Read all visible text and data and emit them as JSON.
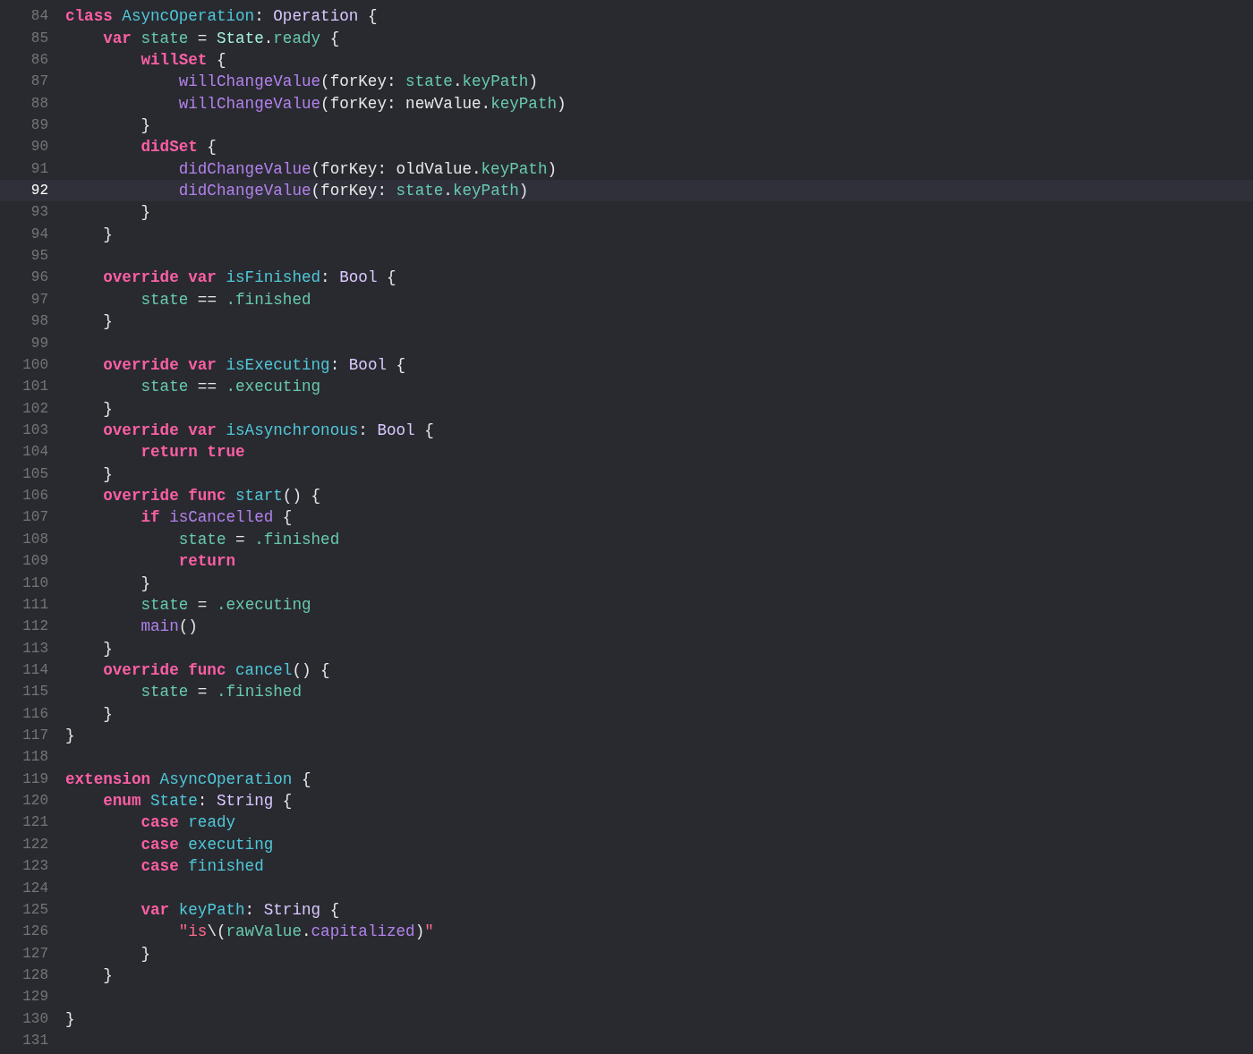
{
  "editor": {
    "lines": [
      {
        "number": "84",
        "selected": false,
        "tokens": [
          {
            "text": "class ",
            "kind": "keyword"
          },
          {
            "text": "AsyncOperation",
            "kind": "declaration"
          },
          {
            "text": ": ",
            "kind": "plain"
          },
          {
            "text": "Operation",
            "kind": "type"
          },
          {
            "text": " {",
            "kind": "plain"
          }
        ]
      },
      {
        "number": "85",
        "selected": false,
        "tokens": [
          {
            "text": "    var ",
            "kind": "keyword"
          },
          {
            "text": "state",
            "kind": "member"
          },
          {
            "text": " = ",
            "kind": "plain"
          },
          {
            "text": "State",
            "kind": "project-type"
          },
          {
            "text": ".",
            "kind": "plain"
          },
          {
            "text": "ready",
            "kind": "member"
          },
          {
            "text": " {",
            "kind": "plain"
          }
        ]
      },
      {
        "number": "86",
        "selected": false,
        "tokens": [
          {
            "text": "        willSet",
            "kind": "keyword"
          },
          {
            "text": " {",
            "kind": "plain"
          }
        ]
      },
      {
        "number": "87",
        "selected": false,
        "tokens": [
          {
            "text": "            willChangeValue",
            "kind": "method"
          },
          {
            "text": "(forKey: ",
            "kind": "plain"
          },
          {
            "text": "state",
            "kind": "member"
          },
          {
            "text": ".",
            "kind": "plain"
          },
          {
            "text": "keyPath",
            "kind": "member"
          },
          {
            "text": ")",
            "kind": "plain"
          }
        ]
      },
      {
        "number": "88",
        "selected": false,
        "tokens": [
          {
            "text": "            willChangeValue",
            "kind": "method"
          },
          {
            "text": "(forKey: newValue.",
            "kind": "plain"
          },
          {
            "text": "keyPath",
            "kind": "member"
          },
          {
            "text": ")",
            "kind": "plain"
          }
        ]
      },
      {
        "number": "89",
        "selected": false,
        "tokens": [
          {
            "text": "        }",
            "kind": "plain"
          }
        ]
      },
      {
        "number": "90",
        "selected": false,
        "tokens": [
          {
            "text": "        didSet",
            "kind": "keyword"
          },
          {
            "text": " {",
            "kind": "plain"
          }
        ]
      },
      {
        "number": "91",
        "selected": false,
        "tokens": [
          {
            "text": "            didChangeValue",
            "kind": "method"
          },
          {
            "text": "(forKey: oldValue.",
            "kind": "plain"
          },
          {
            "text": "keyPath",
            "kind": "member"
          },
          {
            "text": ")",
            "kind": "plain"
          }
        ]
      },
      {
        "number": "92",
        "selected": true,
        "tokens": [
          {
            "text": "            didChangeValue",
            "kind": "method"
          },
          {
            "text": "(forKey: ",
            "kind": "plain"
          },
          {
            "text": "state",
            "kind": "member"
          },
          {
            "text": ".",
            "kind": "plain"
          },
          {
            "text": "keyPath",
            "kind": "member"
          },
          {
            "text": ")",
            "kind": "plain"
          }
        ]
      },
      {
        "number": "93",
        "selected": false,
        "tokens": [
          {
            "text": "        }",
            "kind": "plain"
          }
        ]
      },
      {
        "number": "94",
        "selected": false,
        "tokens": [
          {
            "text": "    }",
            "kind": "plain"
          }
        ]
      },
      {
        "number": "95",
        "selected": false
      },
      {
        "number": "96",
        "selected": false,
        "tokens": [
          {
            "text": "    override var ",
            "kind": "keyword"
          },
          {
            "text": "isFinished",
            "kind": "declaration"
          },
          {
            "text": ": ",
            "kind": "plain"
          },
          {
            "text": "Bool",
            "kind": "type"
          },
          {
            "text": " {",
            "kind": "plain"
          }
        ]
      },
      {
        "number": "97",
        "selected": false,
        "tokens": [
          {
            "text": "        state",
            "kind": "member"
          },
          {
            "text": " == ",
            "kind": "plain"
          },
          {
            "text": ".finished",
            "kind": "member"
          }
        ]
      },
      {
        "number": "98",
        "selected": false,
        "tokens": [
          {
            "text": "    }",
            "kind": "plain"
          }
        ]
      },
      {
        "number": "99",
        "selected": false
      },
      {
        "number": "100",
        "selected": false,
        "tokens": [
          {
            "text": "    override var ",
            "kind": "keyword"
          },
          {
            "text": "isExecuting",
            "kind": "declaration"
          },
          {
            "text": ": ",
            "kind": "plain"
          },
          {
            "text": "Bool",
            "kind": "type"
          },
          {
            "text": " {",
            "kind": "plain"
          }
        ]
      },
      {
        "number": "101",
        "selected": false,
        "tokens": [
          {
            "text": "        state",
            "kind": "member"
          },
          {
            "text": " == ",
            "kind": "plain"
          },
          {
            "text": ".executing",
            "kind": "member"
          }
        ]
      },
      {
        "number": "102",
        "selected": false,
        "tokens": [
          {
            "text": "    }",
            "kind": "plain"
          }
        ]
      },
      {
        "number": "103",
        "selected": false,
        "tokens": [
          {
            "text": "    override var ",
            "kind": "keyword"
          },
          {
            "text": "isAsynchronous",
            "kind": "declaration"
          },
          {
            "text": ": ",
            "kind": "plain"
          },
          {
            "text": "Bool",
            "kind": "type"
          },
          {
            "text": " {",
            "kind": "plain"
          }
        ]
      },
      {
        "number": "104",
        "selected": false,
        "tokens": [
          {
            "text": "        return true",
            "kind": "keyword"
          }
        ]
      },
      {
        "number": "105",
        "selected": false,
        "tokens": [
          {
            "text": "    }",
            "kind": "plain"
          }
        ]
      },
      {
        "number": "106",
        "selected": false,
        "tokens": [
          {
            "text": "    override func ",
            "kind": "keyword"
          },
          {
            "text": "start",
            "kind": "declaration"
          },
          {
            "text": "() {",
            "kind": "plain"
          }
        ]
      },
      {
        "number": "107",
        "selected": false,
        "tokens": [
          {
            "text": "        if ",
            "kind": "keyword"
          },
          {
            "text": "isCancelled",
            "kind": "method"
          },
          {
            "text": " {",
            "kind": "plain"
          }
        ]
      },
      {
        "number": "108",
        "selected": false,
        "tokens": [
          {
            "text": "            state",
            "kind": "member"
          },
          {
            "text": " = ",
            "kind": "plain"
          },
          {
            "text": ".finished",
            "kind": "member"
          }
        ]
      },
      {
        "number": "109",
        "selected": false,
        "tokens": [
          {
            "text": "            return",
            "kind": "keyword"
          }
        ]
      },
      {
        "number": "110",
        "selected": false,
        "tokens": [
          {
            "text": "        }",
            "kind": "plain"
          }
        ]
      },
      {
        "number": "111",
        "selected": false,
        "tokens": [
          {
            "text": "        state",
            "kind": "member"
          },
          {
            "text": " = ",
            "kind": "plain"
          },
          {
            "text": ".executing",
            "kind": "member"
          }
        ]
      },
      {
        "number": "112",
        "selected": false,
        "tokens": [
          {
            "text": "        main",
            "kind": "method"
          },
          {
            "text": "()",
            "kind": "plain"
          }
        ]
      },
      {
        "number": "113",
        "selected": false,
        "tokens": [
          {
            "text": "    }",
            "kind": "plain"
          }
        ]
      },
      {
        "number": "114",
        "selected": false,
        "tokens": [
          {
            "text": "    override func ",
            "kind": "keyword"
          },
          {
            "text": "cancel",
            "kind": "declaration"
          },
          {
            "text": "() {",
            "kind": "plain"
          }
        ]
      },
      {
        "number": "115",
        "selected": false,
        "tokens": [
          {
            "text": "        state",
            "kind": "member"
          },
          {
            "text": " = ",
            "kind": "plain"
          },
          {
            "text": ".finished",
            "kind": "member"
          }
        ]
      },
      {
        "number": "116",
        "selected": false,
        "tokens": [
          {
            "text": "    }",
            "kind": "plain"
          }
        ]
      },
      {
        "number": "117",
        "selected": false,
        "tokens": [
          {
            "text": "}",
            "kind": "plain"
          }
        ]
      },
      {
        "number": "118",
        "selected": false
      },
      {
        "number": "119",
        "selected": false,
        "tokens": [
          {
            "text": "extension ",
            "kind": "keyword"
          },
          {
            "text": "AsyncOperation",
            "kind": "declaration"
          },
          {
            "text": " {",
            "kind": "plain"
          }
        ]
      },
      {
        "number": "120",
        "selected": false,
        "tokens": [
          {
            "text": "    enum ",
            "kind": "keyword"
          },
          {
            "text": "State",
            "kind": "declaration"
          },
          {
            "text": ": ",
            "kind": "plain"
          },
          {
            "text": "String",
            "kind": "type"
          },
          {
            "text": " {",
            "kind": "plain"
          }
        ]
      },
      {
        "number": "121",
        "selected": false,
        "tokens": [
          {
            "text": "        case ",
            "kind": "keyword"
          },
          {
            "text": "ready",
            "kind": "declaration"
          }
        ]
      },
      {
        "number": "122",
        "selected": false,
        "tokens": [
          {
            "text": "        case ",
            "kind": "keyword"
          },
          {
            "text": "executing",
            "kind": "declaration"
          }
        ]
      },
      {
        "number": "123",
        "selected": false,
        "tokens": [
          {
            "text": "        case ",
            "kind": "keyword"
          },
          {
            "text": "finished",
            "kind": "declaration"
          }
        ]
      },
      {
        "number": "124",
        "selected": false
      },
      {
        "number": "125",
        "selected": false,
        "tokens": [
          {
            "text": "        var ",
            "kind": "keyword"
          },
          {
            "text": "keyPath",
            "kind": "declaration"
          },
          {
            "text": ": ",
            "kind": "plain"
          },
          {
            "text": "String",
            "kind": "type"
          },
          {
            "text": " {",
            "kind": "plain"
          }
        ]
      },
      {
        "number": "126",
        "selected": false,
        "tokens": [
          {
            "text": "            \"is",
            "kind": "string"
          },
          {
            "text": "\\(",
            "kind": "plain"
          },
          {
            "text": "rawValue",
            "kind": "member"
          },
          {
            "text": ".",
            "kind": "plain"
          },
          {
            "text": "capitalized",
            "kind": "method"
          },
          {
            "text": ")",
            "kind": "plain"
          },
          {
            "text": "\"",
            "kind": "string"
          }
        ]
      },
      {
        "number": "127",
        "selected": false,
        "tokens": [
          {
            "text": "        }",
            "kind": "plain"
          }
        ]
      },
      {
        "number": "128",
        "selected": false,
        "tokens": [
          {
            "text": "    }",
            "kind": "plain"
          }
        ]
      },
      {
        "number": "129",
        "selected": false
      },
      {
        "number": "130",
        "selected": false,
        "tokens": [
          {
            "text": "}",
            "kind": "plain"
          }
        ]
      },
      {
        "number": "131",
        "selected": false
      }
    ]
  }
}
